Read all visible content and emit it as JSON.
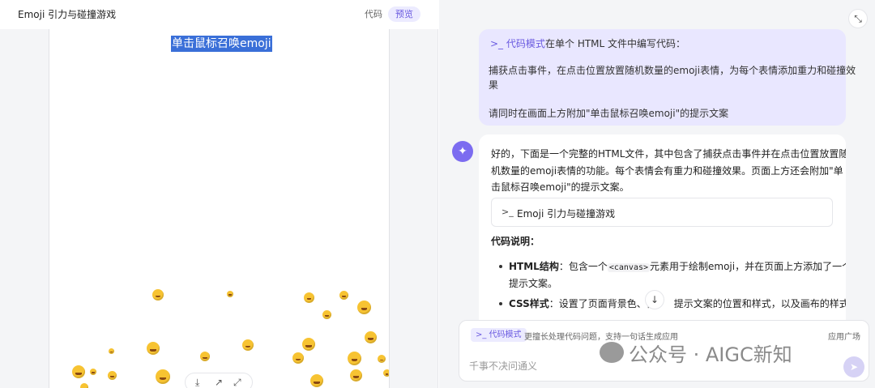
{
  "left_panel": {
    "title": "Emoji 引力与碰撞游戏",
    "tabs": {
      "code": "代码",
      "preview": "预览"
    },
    "preview": {
      "hint_text": "单击鼠标召唤emoji"
    },
    "toolbar": {
      "download_icon": "download-icon",
      "share_icon": "share-icon",
      "fullscreen_icon": "fullscreen-icon"
    }
  },
  "right_panel": {
    "collapse_icon": "collapse-icon",
    "user_message": {
      "mode_label": ">_ 代码模式",
      "intro": "在单个 HTML 文件中编写代码：",
      "line1": "捕获点击事件，在点击位置放置随机数量的emoji表情，为每个表情添加重力和碰撞效",
      "line2": "果",
      "line3": "请同时在画面上方附加\"单击鼠标召唤emoji\"的提示文案"
    },
    "ai_message": {
      "avatar_icon": "assistant-logo-icon",
      "para_line1": "好的，下面是一个完整的HTML文件，其中包含了捕获点击事件并在点击位置放置随",
      "para_line2": "机数量的emoji表情的功能。每个表情会有重力和碰撞效果。页面上方还会附加\"单",
      "para_line3": "击鼠标召唤emoji\"的提示文案。",
      "code_card_label": "Emoji 引力与碰撞游戏",
      "section_title": "代码说明：",
      "bullet1_strong": "HTML结构",
      "bullet1_a": "：包含一个",
      "bullet1_code": "<canvas>",
      "bullet1_b": "元素用于绘制emoji，并在页面上方添加了一个",
      "bullet1_line2": "提示文案。",
      "bullet2_strong": "CSS样式",
      "bullet2_text": "：设置了页面背景色、信",
      "bullet2_tail": "提示文案的位置和样式，以及画布的样式。"
    },
    "input": {
      "mode_chip": ">_ 代码模式",
      "mode_desc": "更擅长处理代码问题，支持一句话生成应用",
      "app_plaza": "应用广场",
      "placeholder": "千事不决问通义",
      "send_icon": "send-icon"
    }
  },
  "watermark": {
    "text": "公众号 · AIGC新知"
  }
}
